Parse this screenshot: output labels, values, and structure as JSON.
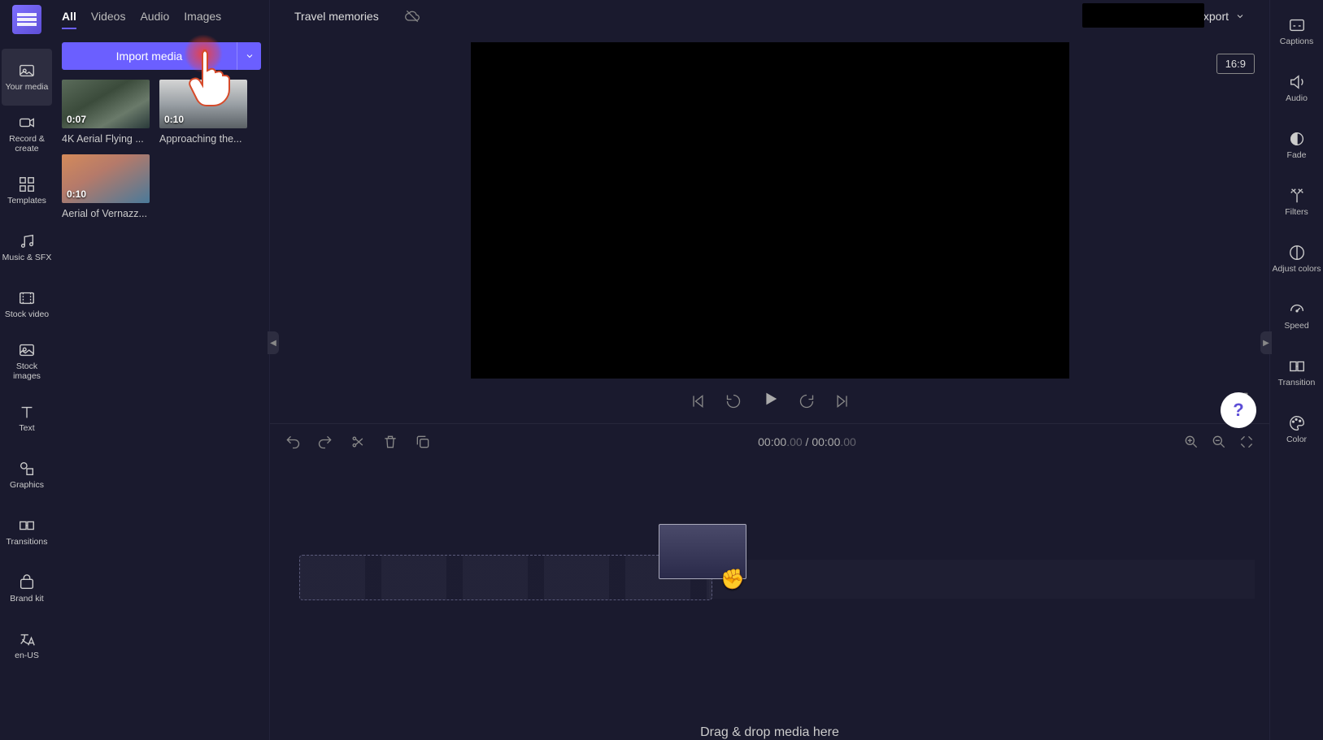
{
  "nav_rail": [
    {
      "label": "Your media",
      "icon": "media-icon"
    },
    {
      "label": "Record & create",
      "icon": "record-icon"
    },
    {
      "label": "Templates",
      "icon": "templates-icon"
    },
    {
      "label": "Music & SFX",
      "icon": "music-icon"
    },
    {
      "label": "Stock video",
      "icon": "stockvideo-icon"
    },
    {
      "label": "Stock images",
      "icon": "stockimages-icon"
    },
    {
      "label": "Text",
      "icon": "text-icon"
    },
    {
      "label": "Graphics",
      "icon": "graphics-icon"
    },
    {
      "label": "Transitions",
      "icon": "transitions-icon"
    },
    {
      "label": "Brand kit",
      "icon": "brandkit-icon"
    },
    {
      "label": "en-US",
      "icon": "language-icon"
    }
  ],
  "media_tabs": [
    "All",
    "Videos",
    "Audio",
    "Images"
  ],
  "import_btn": "Import media",
  "media_items": [
    {
      "duration": "0:07",
      "name": "4K Aerial Flying ...",
      "thumb": "aerial1"
    },
    {
      "duration": "0:10",
      "name": "Approaching the...",
      "thumb": "aerial2"
    },
    {
      "duration": "0:10",
      "name": "Aerial of Vernazz...",
      "thumb": "aerial3"
    }
  ],
  "project_title": "Travel memories",
  "export_label": "Export",
  "aspect_ratio": "16:9",
  "timecode_current": "00:00",
  "timecode_current_frac": ".00",
  "timecode_sep": " / ",
  "timecode_total": "00:00",
  "timecode_total_frac": ".00",
  "drop_hint": "Drag & drop media here",
  "prop_rail": [
    {
      "label": "Captions",
      "icon": "captions-icon"
    },
    {
      "label": "Audio",
      "icon": "audio-icon"
    },
    {
      "label": "Fade",
      "icon": "fade-icon"
    },
    {
      "label": "Filters",
      "icon": "filters-icon"
    },
    {
      "label": "Adjust colors",
      "icon": "adjust-icon"
    },
    {
      "label": "Speed",
      "icon": "speed-icon"
    },
    {
      "label": "Transition",
      "icon": "transition-icon"
    },
    {
      "label": "Color",
      "icon": "color-icon"
    }
  ]
}
